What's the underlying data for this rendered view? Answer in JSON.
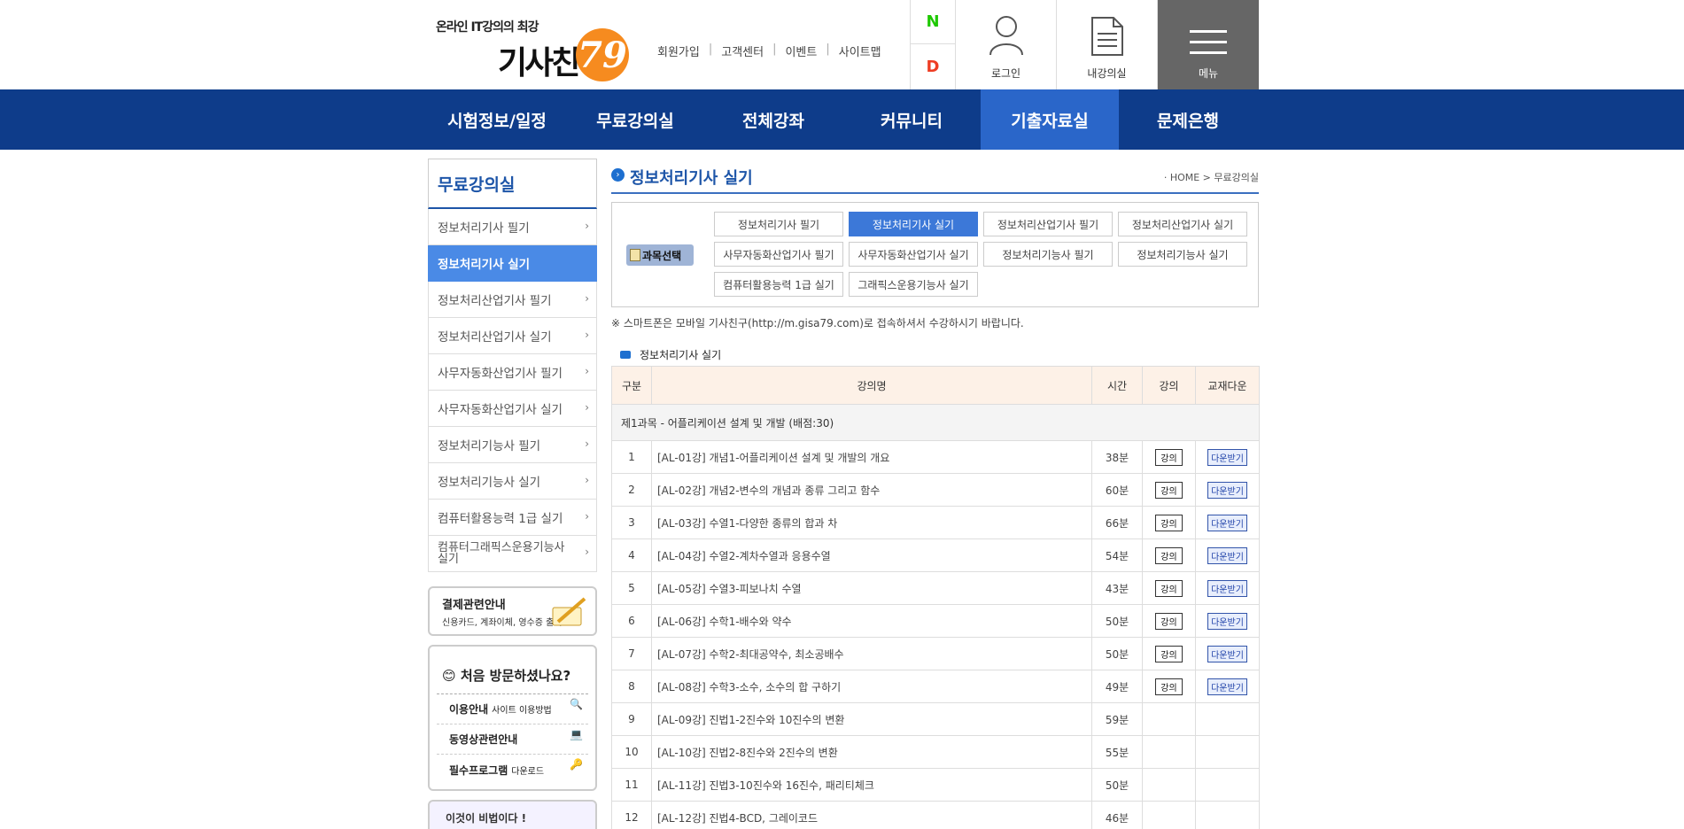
{
  "header": {
    "tagline": "온라인 IT강의의 최강",
    "logo_name": "기사친구",
    "logo_number": "79",
    "util_links": [
      "회원가입",
      "고객센터",
      "이벤트",
      "사이트맵"
    ],
    "sns": [
      "N",
      "D"
    ],
    "login_label": "로그인",
    "my_lecture_label": "내강의실",
    "menu_label": "메뉴"
  },
  "gnb": [
    "시험정보/일정",
    "무료강의실",
    "전체강좌",
    "커뮤니티",
    "기출자료실",
    "문제은행"
  ],
  "lnb": {
    "title": "무료강의실",
    "items": [
      "정보처리기사 필기",
      "정보처리기사 실기",
      "정보처리산업기사 필기",
      "정보처리산업기사 실기",
      "사무자동화산업기사 필기",
      "사무자동화산업기사 실기",
      "정보처리기능사 필기",
      "정보처리기능사 실기",
      "컴퓨터활용능력 1급 실기",
      "컴퓨터그래픽스운용기능사 실기"
    ],
    "selected_index": 1
  },
  "banners": {
    "pay_title": "결제관련안내",
    "pay_sub": "신용카드, 계좌이체, 영수증 출력",
    "first_visit_title": "처음 방문하셨나요?",
    "first_visit_rows": [
      {
        "main": "이용안내",
        "sub": "사이트 이용방법"
      },
      {
        "main": "동영상관련안내",
        "sub": ""
      },
      {
        "main": "필수프로그램",
        "sub": "다운로드"
      }
    ],
    "secret": "이것이 비법이다 !"
  },
  "content": {
    "title": "정보처리기사 실기",
    "location": "HOME > 무료강의실",
    "subject_label": "과목선택",
    "subjects": [
      "정보처리기사 필기",
      "정보처리기사 실기",
      "정보처리산업기사 필기",
      "정보처리산업기사 실기",
      "사무자동화산업기사 필기",
      "사무자동화산업기사 실기",
      "정보처리기능사 필기",
      "정보처리기능사 실기",
      "컴퓨터활용능력 1급 실기",
      "그래픽스운용기능사 실기"
    ],
    "selected_subject": 1,
    "notice": "※ 스마트폰은 모바일 기사친구(http://m.gisa79.com)로 접속하셔서 수강하시기 바랍니다.",
    "list_title": "정보처리기사 실기",
    "columns": [
      "구분",
      "강의명",
      "시간",
      "강의",
      "교재다운"
    ],
    "group_title": "제1과목 - 어플리케이션 설계 및 개발 (배점:30)",
    "lecture_button": "강의",
    "download_button": "다운받기",
    "rows": [
      {
        "no": "1",
        "title": "[AL-01강] 개념1-어플리케이션 설계 및 개발의 개요",
        "time": "38분",
        "has_buttons": true
      },
      {
        "no": "2",
        "title": "[AL-02강] 개념2-변수의 개념과 종류 그리고 함수",
        "time": "60분",
        "has_buttons": true
      },
      {
        "no": "3",
        "title": "[AL-03강] 수열1-다양한 종류의 합과 차",
        "time": "66분",
        "has_buttons": true
      },
      {
        "no": "4",
        "title": "[AL-04강] 수열2-계차수열과 응용수열",
        "time": "54분",
        "has_buttons": true
      },
      {
        "no": "5",
        "title": "[AL-05강] 수열3-피보나치 수열",
        "time": "43분",
        "has_buttons": true
      },
      {
        "no": "6",
        "title": "[AL-06강] 수학1-배수와 약수",
        "time": "50분",
        "has_buttons": true
      },
      {
        "no": "7",
        "title": "[AL-07강] 수학2-최대공약수, 최소공배수",
        "time": "50분",
        "has_buttons": true
      },
      {
        "no": "8",
        "title": "[AL-08강] 수학3-소수, 소수의 합 구하기",
        "time": "49분",
        "has_buttons": true
      },
      {
        "no": "9",
        "title": "[AL-09강] 진법1-2진수와 10진수의 변환",
        "time": "59분",
        "has_buttons": false
      },
      {
        "no": "10",
        "title": "[AL-10강] 진법2-8진수와 2진수의 변환",
        "time": "55분",
        "has_buttons": false
      },
      {
        "no": "11",
        "title": "[AL-11강] 진법3-10진수와 16진수, 패리티체크",
        "time": "50분",
        "has_buttons": false
      },
      {
        "no": "12",
        "title": "[AL-12강] 진법4-BCD, 그레이코드",
        "time": "46분",
        "has_buttons": false
      }
    ]
  },
  "colors": {
    "nav_bg": "#0e3c8a",
    "nav_active": "#2a66c9",
    "accent": "#1d55a8",
    "selected": "#3c78d8",
    "table_header": "#fdf1e7"
  }
}
